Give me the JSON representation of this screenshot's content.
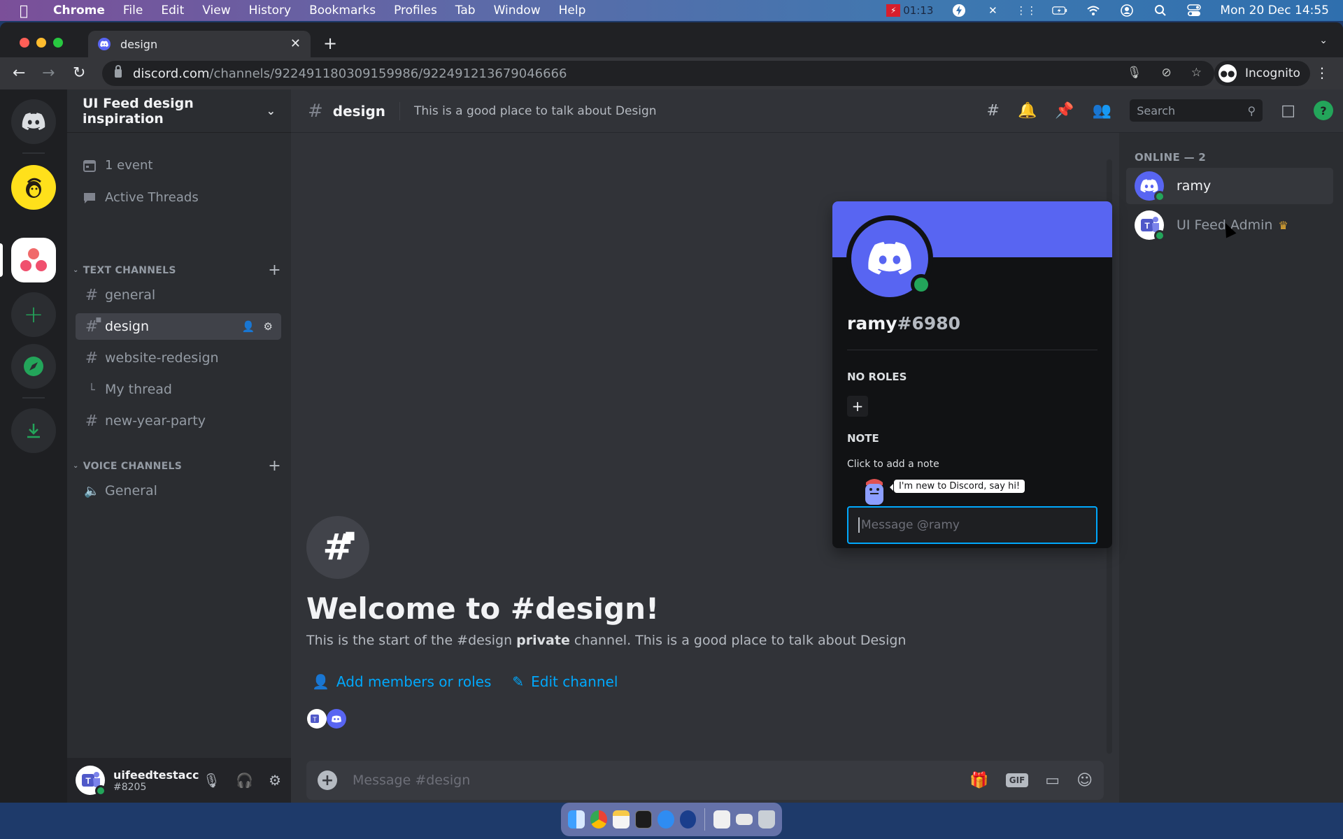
{
  "menubar": {
    "app_name": "Chrome",
    "items": [
      "File",
      "Edit",
      "View",
      "History",
      "Bookmarks",
      "Profiles",
      "Tab",
      "Window",
      "Help"
    ],
    "recording_time": "01:13",
    "clock": "Mon 20 Dec  14:55"
  },
  "browser": {
    "tab_title": "design",
    "url_host": "discord.com",
    "url_path": "/channels/922491180309159986/922491213679046666",
    "profile_label": "Incognito"
  },
  "server": {
    "name": "UI Feed design inspiration",
    "events_label": "1 event",
    "threads_label": "Active Threads",
    "text_category": "TEXT CHANNELS",
    "voice_category": "VOICE CHANNELS",
    "text_channels": [
      {
        "name": "general"
      },
      {
        "name": "design"
      },
      {
        "name": "website-redesign"
      },
      {
        "name": "My thread"
      },
      {
        "name": "new-year-party"
      }
    ],
    "voice_channels": [
      {
        "name": "General"
      }
    ]
  },
  "user_panel": {
    "username": "uifeedtestacc",
    "discriminator": "#8205"
  },
  "channel": {
    "name": "design",
    "topic": "This is a good place to talk about Design",
    "search_placeholder": "Search",
    "welcome_title": "Welcome to #design!",
    "welcome_pre": "This is the start of the #design ",
    "welcome_bold": "private",
    "welcome_post": " channel. This is a good place to talk about Design",
    "add_members_label": "Add members or roles",
    "edit_channel_label": "Edit channel",
    "composer_placeholder": "Message #design",
    "gif_label": "GIF"
  },
  "members": {
    "online_header": "ONLINE — 2",
    "list": [
      {
        "name": "ramy"
      },
      {
        "name": "UI Feed Admin"
      }
    ]
  },
  "profile_popout": {
    "username": "ramy",
    "tag": "#6980",
    "roles_label": "NO ROLES",
    "note_label": "NOTE",
    "note_placeholder": "Click to add a note",
    "new_user_bubble": "I'm new to Discord, say hi!",
    "message_placeholder": "Message @ramy"
  },
  "colors": {
    "blurple": "#5865f2",
    "online": "#23a55a",
    "link": "#00a8fc"
  }
}
